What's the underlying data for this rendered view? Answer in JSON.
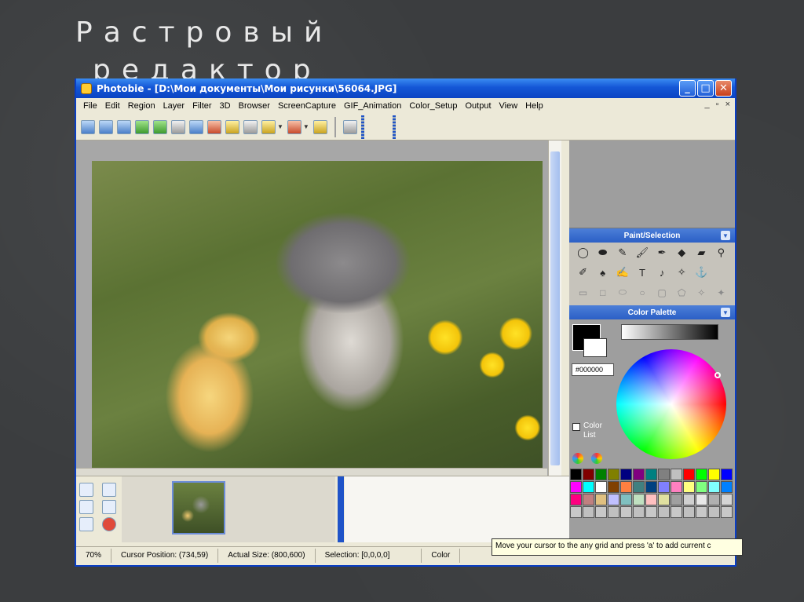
{
  "slide": {
    "title_line1": "Растровый",
    "title_line2": "редактор"
  },
  "window": {
    "title": "Photobie - [D:\\Мои документы\\Мои рисунки\\56064.JPG]",
    "controls": {
      "minimize": "_",
      "maximize": "□",
      "close": "✕"
    }
  },
  "menu": [
    "File",
    "Edit",
    "Region",
    "Layer",
    "Filter",
    "3D",
    "Browser",
    "ScreenCapture",
    "GIF_Animation",
    "Color_Setup",
    "Output",
    "View",
    "Help"
  ],
  "mdi_controls": [
    "_",
    "▫",
    "×"
  ],
  "panels": {
    "paint_selection": {
      "title": "Paint/Selection"
    },
    "color_palette": {
      "title": "Color Palette",
      "hex_value": "#000000",
      "color_list_label": "Color List"
    }
  },
  "palette_colors": [
    "#000000",
    "#800000",
    "#008000",
    "#808000",
    "#000080",
    "#800080",
    "#008080",
    "#808080",
    "#c0c0c0",
    "#ff0000",
    "#00ff00",
    "#ffff00",
    "#0000ff",
    "#ff00ff",
    "#00ffff",
    "#ffffff",
    "#804000",
    "#ff8040",
    "#408080",
    "#004080",
    "#8080ff",
    "#ff80c0",
    "#ffff80",
    "#80ff80",
    "#80ffff",
    "#0080ff",
    "#ff0080",
    "#c08080",
    "#e0c080",
    "#c0c0ff",
    "#80c0c0",
    "#c0e0c0",
    "#ffc0c0",
    "#e0e0a0",
    "#a0a0a0",
    "#d0d0d0",
    "#e8e8e8",
    "#b0b0b0",
    "#d4d4d4",
    "#c8c8c8",
    "#c0c0c0",
    "#c8c8c8",
    "#c0c0c0",
    "#c8c8c8",
    "#c0c0c0",
    "#c8c8c8",
    "#c0c0c0",
    "#c8c8c8",
    "#c0c0c0",
    "#c8c8c8",
    "#c0c0c0",
    "#c8c8c8"
  ],
  "tooltip": "Move your cursor to the any grid and press 'a' to add current c",
  "status": {
    "zoom": "70%",
    "cursor": "Cursor Position: (734,59)",
    "actual_size": "Actual Size: (800,600)",
    "selection": "Selection: [0,0,0,0]",
    "color": "Color"
  }
}
